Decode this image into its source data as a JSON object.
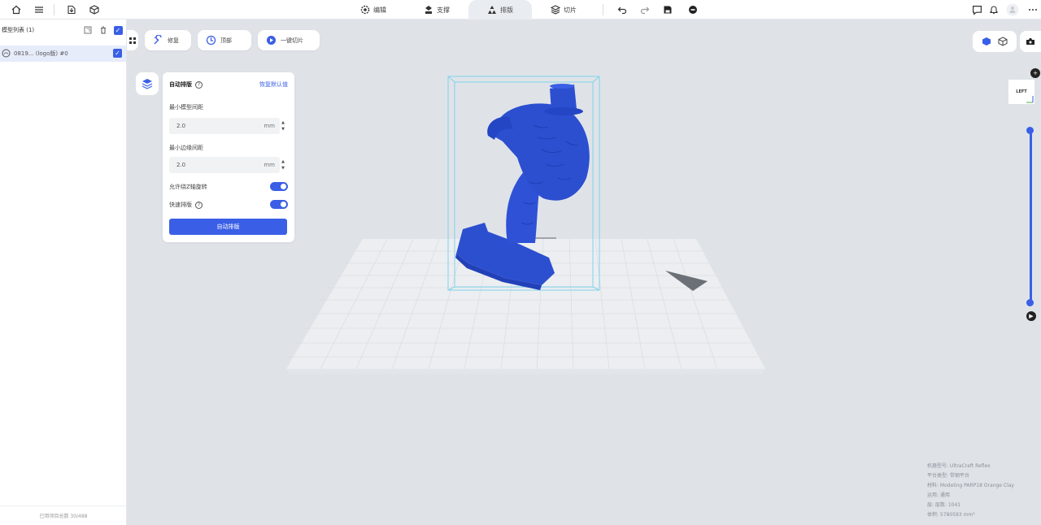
{
  "topbar": {
    "tabs": [
      {
        "label": "编辑",
        "icon": "gear-icon"
      },
      {
        "label": "支撑",
        "icon": "support-icon"
      },
      {
        "label": "排版",
        "icon": "layout-icon",
        "active": true
      },
      {
        "label": "切片",
        "icon": "slice-icon"
      }
    ]
  },
  "left_panel": {
    "title": "模型列表 (1)",
    "item_label": "0819... (logo版) #0",
    "footer": "已用项目总数 30/488"
  },
  "toolbar": {
    "buttons": [
      "修复",
      "顶部",
      "一键切片"
    ]
  },
  "layout_panel": {
    "title": "自动排版",
    "reset_link": "恢复默认值",
    "min_model_gap_label": "最小模型间距",
    "min_model_gap_value": "2.0",
    "min_edge_gap_label": "最小边缘间距",
    "min_edge_gap_value": "2.0",
    "unit": "mm",
    "allow_z_rotate_label": "允许绕Z轴旋转",
    "fast_layout_label": "快速排版",
    "submit_label": "自动排版"
  },
  "viewcube": {
    "face_label": "LEFT"
  },
  "info": {
    "printer": "机器型号: UltraCraft Reflex",
    "platform": "平台类型: 带钢平台",
    "material": "材料: Modeling PARP18 Orange Clay",
    "usage": "运用: 通用",
    "layers": "层: 层数: 1041",
    "volume": "体积: 5780593 mm³"
  },
  "colors": {
    "accent": "#3a5fe6",
    "model": "#2c4fd0",
    "bbox": "#7fd3ec"
  }
}
